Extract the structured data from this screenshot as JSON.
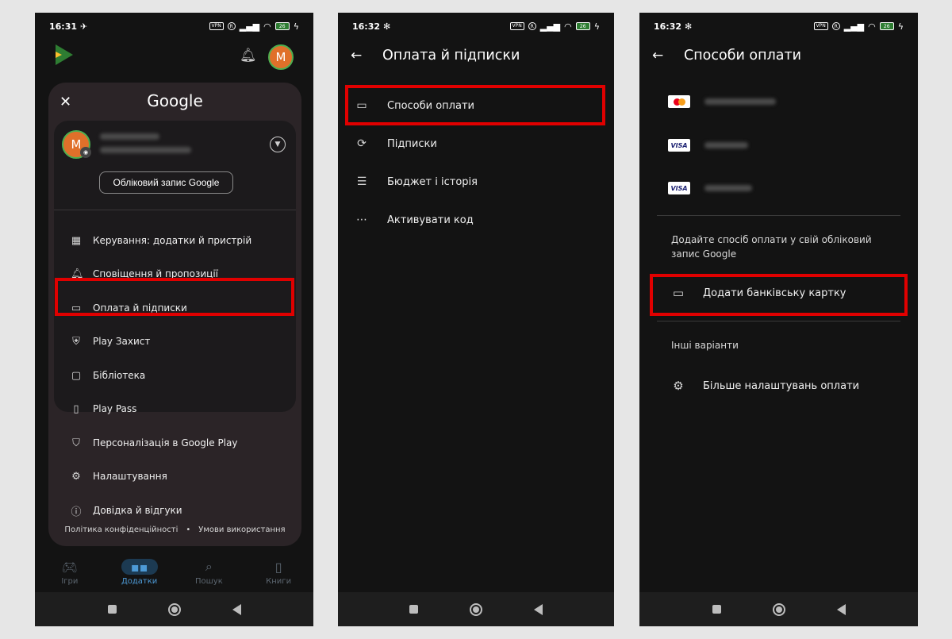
{
  "panel1": {
    "time": "16:31",
    "battery": "26",
    "vpn": "VPN",
    "top_avatar": "M",
    "brand": "Google",
    "account": {
      "avatar": "M",
      "manage_button": "Обліковий запис Google"
    },
    "menu_items": [
      {
        "label": "Керування: додатки й пристрій",
        "icon": "grid-icon"
      },
      {
        "label": "Сповіщення й пропозиції",
        "icon": "bell-icon"
      },
      {
        "label": "Оплата й підписки",
        "icon": "card-icon"
      },
      {
        "label": "Play Захист",
        "icon": "shield-icon"
      },
      {
        "label": "Бібліотека",
        "icon": "folder-icon"
      },
      {
        "label": "Play Pass",
        "icon": "ticket-icon"
      },
      {
        "label": "Персоналізація в Google Play",
        "icon": "shield-person-icon"
      },
      {
        "label": "Налаштування",
        "icon": "gear-icon"
      },
      {
        "label": "Довідка й відгуки",
        "icon": "help-icon"
      }
    ],
    "footer": {
      "privacy": "Політика конфіденційності",
      "dot": "•",
      "terms": "Умови використання"
    },
    "tabs": [
      {
        "label": "Ігри",
        "icon": "gamepad-icon"
      },
      {
        "label": "Додатки",
        "icon": "apps-icon"
      },
      {
        "label": "Пошук",
        "icon": "search-icon"
      },
      {
        "label": "Книги",
        "icon": "book-icon"
      }
    ]
  },
  "panel2": {
    "time": "16:32",
    "battery": "26",
    "vpn": "VPN",
    "title": "Оплата й підписки",
    "items": [
      {
        "label": "Способи оплати",
        "icon": "card-icon"
      },
      {
        "label": "Підписки",
        "icon": "refresh-icon"
      },
      {
        "label": "Бюджет і історія",
        "icon": "list-icon"
      },
      {
        "label": "Активувати код",
        "icon": "code-icon"
      }
    ]
  },
  "panel3": {
    "time": "16:32",
    "battery": "26",
    "vpn": "VPN",
    "title": "Способи оплати",
    "cards": [
      {
        "brand": "mastercard"
      },
      {
        "brand": "VISA"
      },
      {
        "brand": "VISA"
      }
    ],
    "add_hint": "Додайте спосіб оплати у свій обліковий запис Google",
    "add_card": "Додати банківську картку",
    "other_header": "Інші варіанти",
    "more_settings": "Більше налаштувань оплати"
  },
  "colors": {
    "highlight": "#e00000",
    "accent": "#4d9ad6"
  }
}
